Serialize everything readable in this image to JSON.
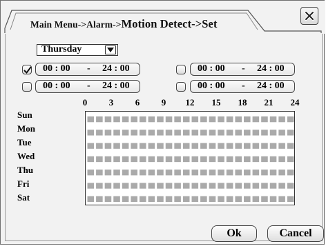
{
  "title": {
    "prefix": "Main Menu->Alarm->",
    "suffix": "Motion Detect->Set"
  },
  "day_select": {
    "value": "Thursday"
  },
  "periods": [
    {
      "checked": true,
      "start": "00 : 00",
      "dash": "-",
      "end": "24 : 00"
    },
    {
      "checked": false,
      "start": "00 : 00",
      "dash": "-",
      "end": "24 : 00"
    },
    {
      "checked": false,
      "start": "00 : 00",
      "dash": "-",
      "end": "24 : 00"
    },
    {
      "checked": false,
      "start": "00 : 00",
      "dash": "-",
      "end": "24 : 00"
    }
  ],
  "hour_ticks": [
    "0",
    "3",
    "6",
    "9",
    "12",
    "15",
    "18",
    "21",
    "24"
  ],
  "days": [
    "Sun",
    "Mon",
    "Tue",
    "Wed",
    "Thu",
    "Fri",
    "Sat"
  ],
  "schedule": {
    "hours_per_day": 24,
    "all_hours_selected": true
  },
  "buttons": {
    "ok": "Ok",
    "cancel": "Cancel"
  },
  "icons": {
    "close": "close-x-icon",
    "dropdown": "triangle-down-icon",
    "check": "checkmark-icon"
  },
  "colors": {
    "schedule_fill": "#aaaaaa",
    "background": "#f2f2f2"
  }
}
